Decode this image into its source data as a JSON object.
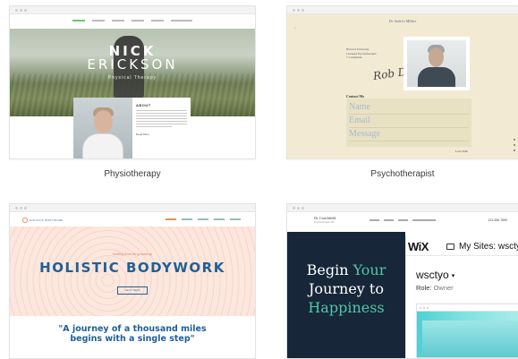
{
  "templates": [
    {
      "caption": "Physiotherapy",
      "preview": {
        "name_line1": "NICK",
        "name_line2": "ERICKSON",
        "subtitle": "Physical Therapy",
        "about_heading": "ABOUT",
        "read_more": "Read More"
      }
    },
    {
      "caption": "Psychotherapist",
      "preview": {
        "doctor_name": "Dr. Andre's Millers",
        "qualifications": [
          "Harvard University",
          "Licensed Psychotherapist",
          "+ Credentials"
        ],
        "signature": "Rob Dk",
        "contact_heading": "Contact Me",
        "form_fields": [
          "Name",
          "Email",
          "Message"
        ],
        "submit": "Let's Talk"
      }
    },
    {
      "caption": "",
      "preview": {
        "logo": "HOLISTIC BODYWORK",
        "kicker": "healing from the ground up",
        "headline": "HOLISTIC BODYWORK",
        "button": "Get in Touch",
        "quote_line1": "\"A journey of a thousand miles",
        "quote_line2": "begins with a single step\""
      }
    },
    {
      "caption": "",
      "preview": {
        "doctor_name": "Dr. Crutchfield",
        "doctor_sub": "Psychotherapist, MD",
        "phone": "123-456-7890",
        "headline_line1_a": "Begin ",
        "headline_line1_b": "Your",
        "headline_line2": "Journey to",
        "headline_line3": "Happiness"
      }
    }
  ],
  "wix_overlay": {
    "logo": "WiX",
    "site_icon": "site-icon",
    "title": "My Sites: wsctyo",
    "site_name": "wsctyo",
    "caret": "▾",
    "role_label": "Role: ",
    "role_value": "Owner"
  },
  "colors": {
    "physio_accent": "#5cb85c",
    "holistic_blue": "#1f5f97",
    "holistic_orange": "#e07a55",
    "dark_navy": "#172638",
    "teal_accent": "#4fc8a6"
  }
}
